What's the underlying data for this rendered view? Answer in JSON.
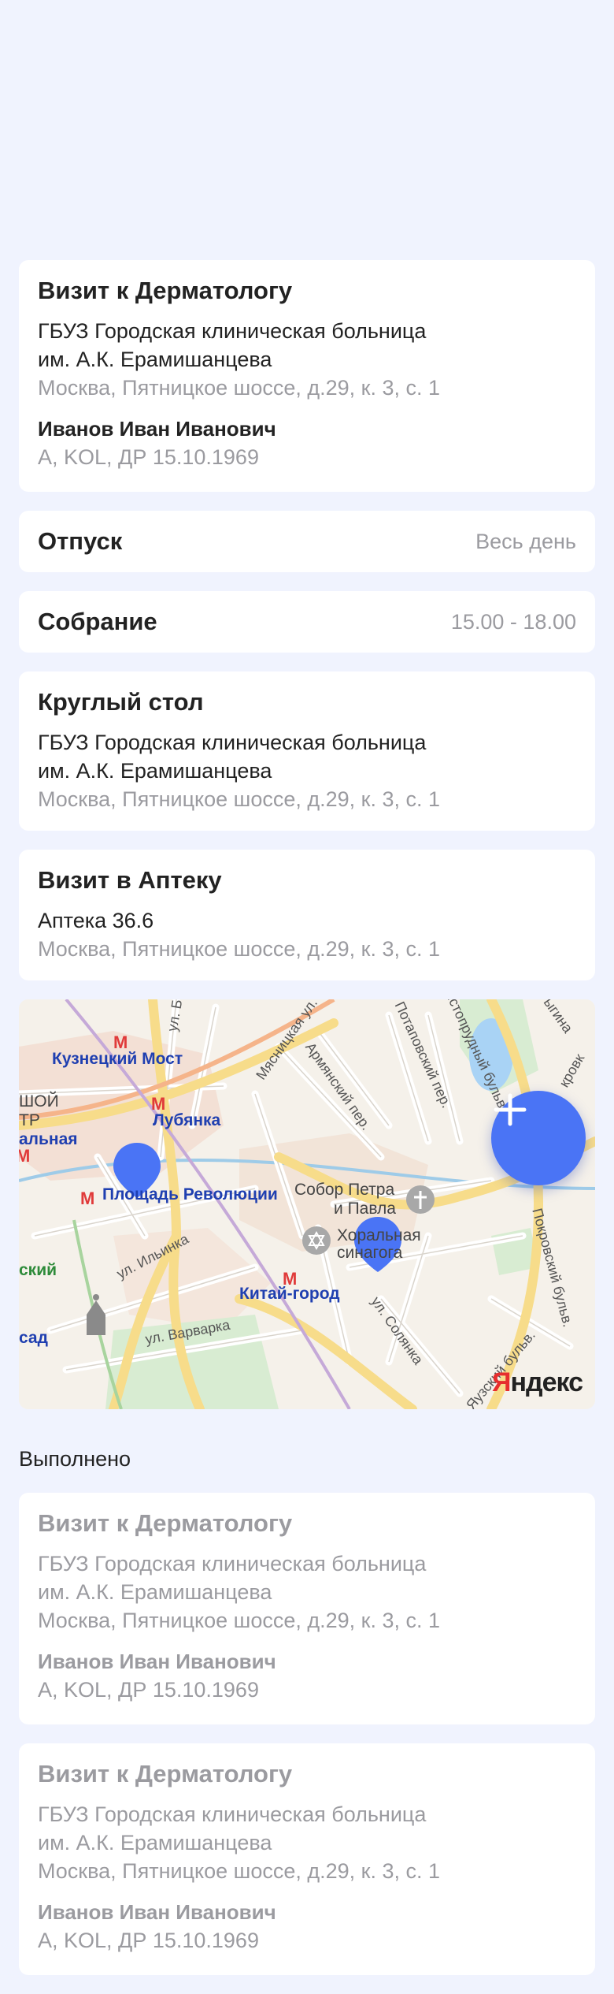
{
  "cards": [
    {
      "title": "Визит к Дерматологу",
      "org_line1": "ГБУЗ Городская клиническая больница",
      "org_line2": "им. А.К. Ерамишанцева",
      "address": "Москва, Пятницкое шоссе, д.29, к. 3, с. 1",
      "person": "Иванов Иван Иванович",
      "person_details": "А, KOL, ДР 15.10.1969"
    },
    {
      "title": "Отпуск",
      "time": "Весь день"
    },
    {
      "title": "Собрание",
      "time": "15.00 - 18.00"
    },
    {
      "title": "Круглый стол",
      "org_line1": "ГБУЗ Городская клиническая больница",
      "org_line2": "им. А.К. Ерамишанцева",
      "address": "Москва, Пятницкое шоссе, д.29, к. 3, с. 1"
    },
    {
      "title": "Визит в Аптеку",
      "org_line1": "Аптека 36.6",
      "address": "Москва, Пятницкое шоссе, д.29, к. 3, с. 1"
    }
  ],
  "map": {
    "labels": {
      "kuznetsky": "Кузнецкий Мост",
      "lubyanka": "Лубянка",
      "ploshchad": "Площадь Революции",
      "kitay": "Китай-город",
      "sobor": "Собор Петра",
      "sobor2": "и Павла",
      "sinagoga": "Хоральная",
      "sinagoga2": "синагога",
      "ilyinka": "ул. Ильинка",
      "varvarka": "ул. Варварка",
      "solyanka": "ул. Солянка",
      "armyansky": "Армянский пер.",
      "myasnitskaya": "Мясницкая ул.",
      "potapovsky": "Потаповский пер.",
      "chistoprudny": "Чистопрудный бульв.",
      "pokrovsky": "Покровский бульв.",
      "yauzsky": "Яузский бульв.",
      "edge_top_left": "ШОЙ",
      "edge_tr": "ТР",
      "edge_alnaya": "альная",
      "edge_skiy": "ский",
      "edge_sad": "сад",
      "edge_ul_b": "ул. Б",
      "edge_kirovka": "кровк",
      "edge_yigina": "ыгина"
    },
    "logo_first": "Я",
    "logo_rest": "ндекс",
    "fab_icon": "plus-icon",
    "accent": "#4a74f5"
  },
  "completed_title": "Выполнено",
  "completed": [
    {
      "title": "Визит к Дерматологу",
      "org_line1": "ГБУЗ Городская клиническая больница",
      "org_line2": "им. А.К. Ерамишанцева",
      "address": "Москва, Пятницкое шоссе, д.29, к. 3, с. 1",
      "person": "Иванов Иван Иванович",
      "person_details": "А, KOL, ДР 15.10.1969"
    },
    {
      "title": "Визит к Дерматологу",
      "org_line1": "ГБУЗ Городская клиническая больница",
      "org_line2": "им. А.К. Ерамишанцева",
      "address": "Москва, Пятницкое шоссе, д.29, к. 3, с. 1",
      "person": "Иванов Иван Иванович",
      "person_details": "А, KOL, ДР 15.10.1969"
    }
  ]
}
